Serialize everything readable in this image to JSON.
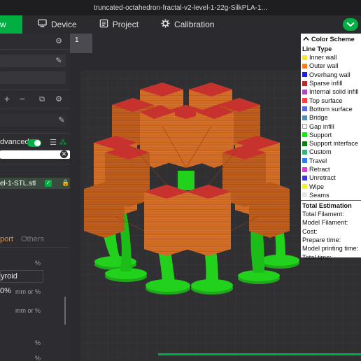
{
  "window": {
    "title": "truncated-octahedron-fractal-v2-level-1-22g-SilkPLA-1..."
  },
  "tabs": [
    {
      "label": "w",
      "icon": "prepare-icon"
    },
    {
      "label": "Device",
      "icon": "device-icon"
    },
    {
      "label": "Project",
      "icon": "project-icon"
    },
    {
      "label": "Calibration",
      "icon": "calibration-icon"
    }
  ],
  "left_panel": {
    "advanced_label": "dvanced",
    "advanced_on": true,
    "object_name": "el-1-STL.stl",
    "tab_support": "port",
    "tab_others": "Others",
    "percent_1": "%",
    "pattern_value": "yroid",
    "density_value": "0%",
    "unit_1": "mm or %",
    "unit_2": "mm or %",
    "percent_2": "%",
    "percent_3": "%",
    "plus": "+",
    "minus": "−"
  },
  "viewport": {
    "plate_number": "1"
  },
  "legend": {
    "title": "Color Scheme",
    "subtitle": "Line Type",
    "items": [
      {
        "label": "Inner wall",
        "color": "#f7e23e"
      },
      {
        "label": "Outer wall",
        "color": "#ff7b1d"
      },
      {
        "label": "Overhang wall",
        "color": "#1c1fe0"
      },
      {
        "label": "Sparse infill",
        "color": "#b02d2d"
      },
      {
        "label": "Internal solid infill",
        "color": "#a64bb8"
      },
      {
        "label": "Top surface",
        "color": "#f24141"
      },
      {
        "label": "Bottom surface",
        "color": "#5a6bd6"
      },
      {
        "label": "Bridge",
        "color": "#4e8fb8"
      },
      {
        "label": "Gap infill",
        "color": "#ffffff"
      },
      {
        "label": "Support",
        "color": "#15e812"
      },
      {
        "label": "Support interface",
        "color": "#147a14"
      },
      {
        "label": "Custom",
        "color": "#3bb07a"
      },
      {
        "label": "Travel",
        "color": "#2d7df0"
      },
      {
        "label": "Retract",
        "color": "#d940d0"
      },
      {
        "label": "Unretract",
        "color": "#3a3ae0"
      },
      {
        "label": "Wipe",
        "color": "#f2f23a"
      },
      {
        "label": "Seams",
        "color": "#e6e6e6"
      }
    ],
    "estimation_title": "Total Estimation",
    "estimation": [
      "Total Filament:",
      "Model Filament:",
      "Cost:",
      "Prepare time:",
      "Model printing time:",
      "Total time:"
    ]
  },
  "colors": {
    "accent": "#00ae42",
    "model_orange": "#d9732a",
    "model_dark": "#b85c1c",
    "top_red": "#c8322e",
    "support_green": "#22d11c"
  }
}
